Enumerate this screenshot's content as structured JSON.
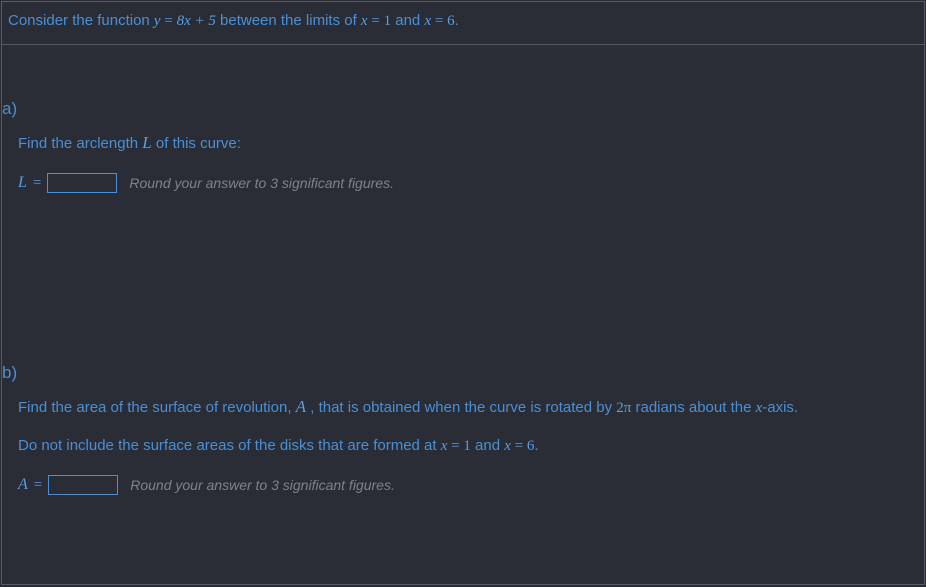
{
  "intro": {
    "pre": "Consider the function ",
    "fn_lhs": "y",
    "fn_eq": " = ",
    "fn_rhs": "8x + 5",
    "mid": " between the limits of ",
    "lim1_var": "x",
    "lim1_eq": " = ",
    "lim1_val": "1",
    "and": " and ",
    "lim2_var": "x",
    "lim2_eq": " = ",
    "lim2_val": "6",
    "end": "."
  },
  "partA": {
    "label": "a)",
    "prompt_pre": "Find the arclength ",
    "prompt_L": "L",
    "prompt_post": " of this curve:",
    "var": "L",
    "eq": "=",
    "hint": "Round your answer to 3 significant figures."
  },
  "partB": {
    "label": "b)",
    "line1_pre": "Find the area of the surface of revolution, ",
    "line1_A": "A",
    "line1_mid": " , that is obtained when the curve is rotated by ",
    "line1_2pi": "2π",
    "line1_mid2": " radians about the ",
    "line1_xaxis": "x",
    "line1_post": "-axis.",
    "line2_pre": "Do not include the surface areas of the disks that are formed at ",
    "line2_x1v": "x",
    "line2_eq1": " = ",
    "line2_v1": "1",
    "line2_and": " and ",
    "line2_x2v": "x",
    "line2_eq2": " = ",
    "line2_v2": "6",
    "line2_end": ".",
    "var": "A",
    "eq": "=",
    "hint": "Round your answer to 3 significant figures."
  }
}
